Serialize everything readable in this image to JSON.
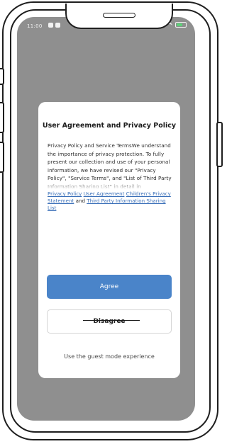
{
  "status_bar": {
    "time": "11:00",
    "icons": [
      "notification-icon",
      "message-icon",
      "signal-icon",
      "wifi-icon",
      "battery-icon"
    ],
    "battery_color": "#5fd07a"
  },
  "dialog": {
    "title": "User Agreement and Privacy Policy",
    "body": "Privacy Policy and Service TermsWe understand the importance of privacy protection. To fully present our collection and use of your personal information, we have revised our \"Privacy Policy\", \"Service Terms\", and \"List of Third Party Information Sharing List\" in detail in accordance with the latest laws and regulations.",
    "links": {
      "privacy_policy": "Privacy Policy",
      "user_agreement": "User Agreement",
      "childrens_privacy": "Children's Privacy Statement",
      "and": "and",
      "third_party": "Third Party Information Sharing List"
    },
    "agree_label": "Agree",
    "disagree_label": "Disagree",
    "guest_label": "Use the guest mode experience"
  },
  "colors": {
    "overlay": "#8f8f8f",
    "primary": "#4a84c9",
    "link": "#3a6fb8"
  }
}
